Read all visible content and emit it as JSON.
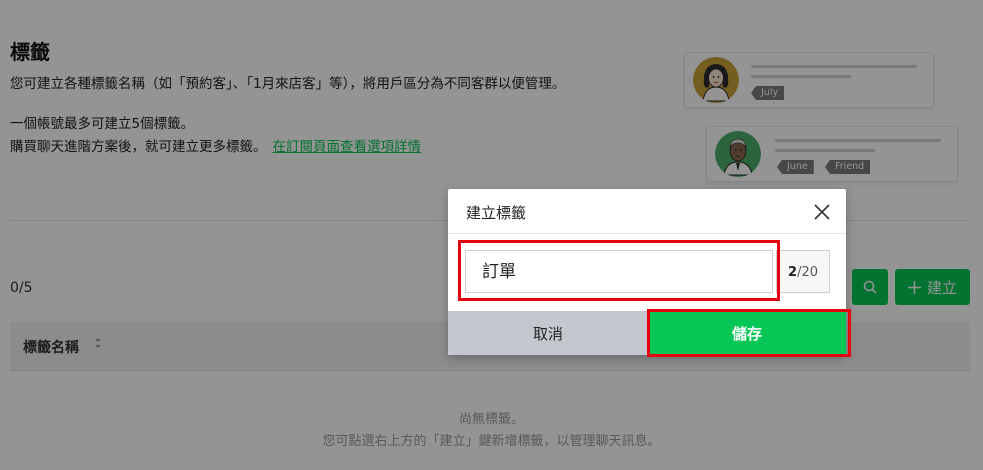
{
  "header": {
    "title": "標籤",
    "description": "您可建立各種標籤名稱（如「預約客」、「1月來店客」等），將用戶區分為不同客群以便管理。",
    "limit_text": "一個帳號最多可建立5個標籤。",
    "upgrade_text": "購買聊天進階方案後，就可建立更多標籤。",
    "upgrade_link": "在訂閱頁面查看選項詳情"
  },
  "illustration": {
    "card1": {
      "tags": [
        "July"
      ]
    },
    "card2": {
      "tags": [
        "June",
        "Friend"
      ]
    }
  },
  "toolbar": {
    "count": "0/5",
    "search_icon": "search-icon",
    "create_label": "建立",
    "create_icon": "plus-icon"
  },
  "table": {
    "header_label": "標籤名稱",
    "sort_icon": "sort-icon"
  },
  "empty_state": {
    "line1": "尚無標籤。",
    "line2": "您可點選右上方的「建立」鍵新增標籤，以管理聊天訊息。"
  },
  "modal": {
    "title": "建立標籤",
    "close_icon": "close-icon",
    "input_value": "訂單",
    "counter_current": "2",
    "counter_max": "/20",
    "cancel_label": "取消",
    "save_label": "儲存"
  },
  "colors": {
    "brand_green": "#06c755",
    "highlight_red": "#e60012",
    "overlay": "rgba(0,0,0,0.42)"
  }
}
